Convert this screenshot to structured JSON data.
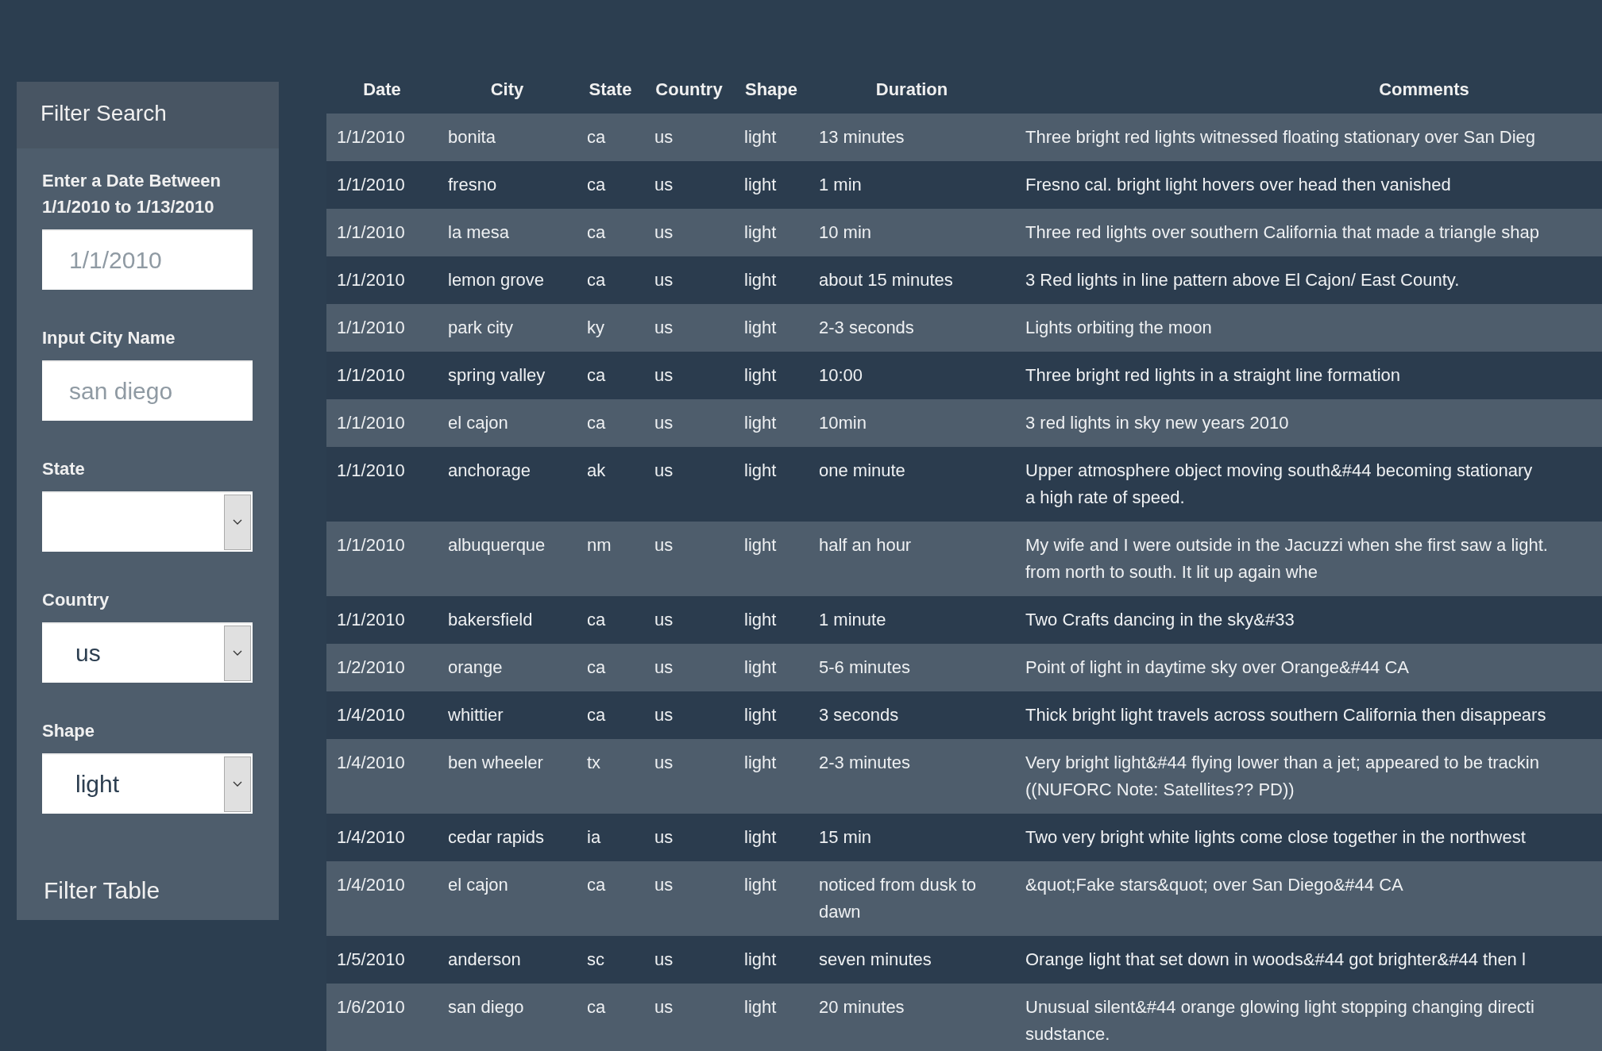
{
  "sidebar": {
    "title": "Filter Search",
    "fields": [
      {
        "kind": "text",
        "label": "Enter a Date Between 1/1/2010 to 1/13/2010",
        "placeholder": "1/1/2010"
      },
      {
        "kind": "text",
        "label": "Input City Name",
        "placeholder": "san diego"
      },
      {
        "kind": "select",
        "label": "State"
      },
      {
        "kind": "select",
        "label": "Country",
        "value": "us"
      },
      {
        "kind": "select",
        "label": "Shape",
        "value": "light"
      }
    ],
    "button": "Filter Table"
  },
  "table": {
    "columns": [
      "Date",
      "City",
      "State",
      "Country",
      "Shape",
      "Duration",
      "Comments"
    ],
    "rows": [
      [
        "1/1/2010",
        "bonita",
        "ca",
        "us",
        "light",
        "13 minutes",
        "Three bright red lights witnessed floating stationary over San Dieg"
      ],
      [
        "1/1/2010",
        "fresno",
        "ca",
        "us",
        "light",
        "1 min",
        "Fresno cal. bright light hovers over head then vanished"
      ],
      [
        "1/1/2010",
        "la mesa",
        "ca",
        "us",
        "light",
        "10 min",
        "Three red lights over southern California that made a triangle shap"
      ],
      [
        "1/1/2010",
        "lemon grove",
        "ca",
        "us",
        "light",
        "about 15 minutes",
        "3 Red lights in line pattern above El Cajon/ East County."
      ],
      [
        "1/1/2010",
        "park city",
        "ky",
        "us",
        "light",
        "2-3 seconds",
        "Lights orbiting the moon"
      ],
      [
        "1/1/2010",
        "spring valley",
        "ca",
        "us",
        "light",
        "10:00",
        "Three bright red lights in a straight line formation"
      ],
      [
        "1/1/2010",
        "el cajon",
        "ca",
        "us",
        "light",
        "10min",
        "3 red lights in sky new years 2010"
      ],
      [
        "1/1/2010",
        "anchorage",
        "ak",
        "us",
        "light",
        "one minute",
        "Upper atmosphere object moving south&#44 becoming stationary\na high rate of speed."
      ],
      [
        "1/1/2010",
        "albuquerque",
        "nm",
        "us",
        "light",
        "half an hour",
        "My wife and I were outside in the Jacuzzi when she first saw a light.\nfrom north to south. It lit up again whe"
      ],
      [
        "1/1/2010",
        "bakersfield",
        "ca",
        "us",
        "light",
        "1 minute",
        "Two Crafts dancing in the sky&#33"
      ],
      [
        "1/2/2010",
        "orange",
        "ca",
        "us",
        "light",
        "5-6 minutes",
        "Point of light in daytime sky over Orange&#44 CA"
      ],
      [
        "1/4/2010",
        "whittier",
        "ca",
        "us",
        "light",
        "3 seconds",
        "Thick bright light travels across southern California then disappears"
      ],
      [
        "1/4/2010",
        "ben wheeler",
        "tx",
        "us",
        "light",
        "2-3 minutes",
        "Very bright light&#44 flying lower than a jet; appeared to be trackin\n((NUFORC Note: Satellites?? PD))"
      ],
      [
        "1/4/2010",
        "cedar rapids",
        "ia",
        "us",
        "light",
        "15 min",
        "Two very bright white lights come close together in the northwest"
      ],
      [
        "1/4/2010",
        "el cajon",
        "ca",
        "us",
        "light",
        "noticed from dusk to\ndawn",
        "&quot;Fake stars&quot; over San Diego&#44 CA"
      ],
      [
        "1/5/2010",
        "anderson",
        "sc",
        "us",
        "light",
        "seven minutes",
        "Orange light that set down in woods&#44 got brighter&#44 then l"
      ],
      [
        "1/6/2010",
        "san diego",
        "ca",
        "us",
        "light",
        "20 minutes",
        "Unusual silent&#44 orange glowing light stopping changing directi\nsudstance."
      ]
    ]
  }
}
